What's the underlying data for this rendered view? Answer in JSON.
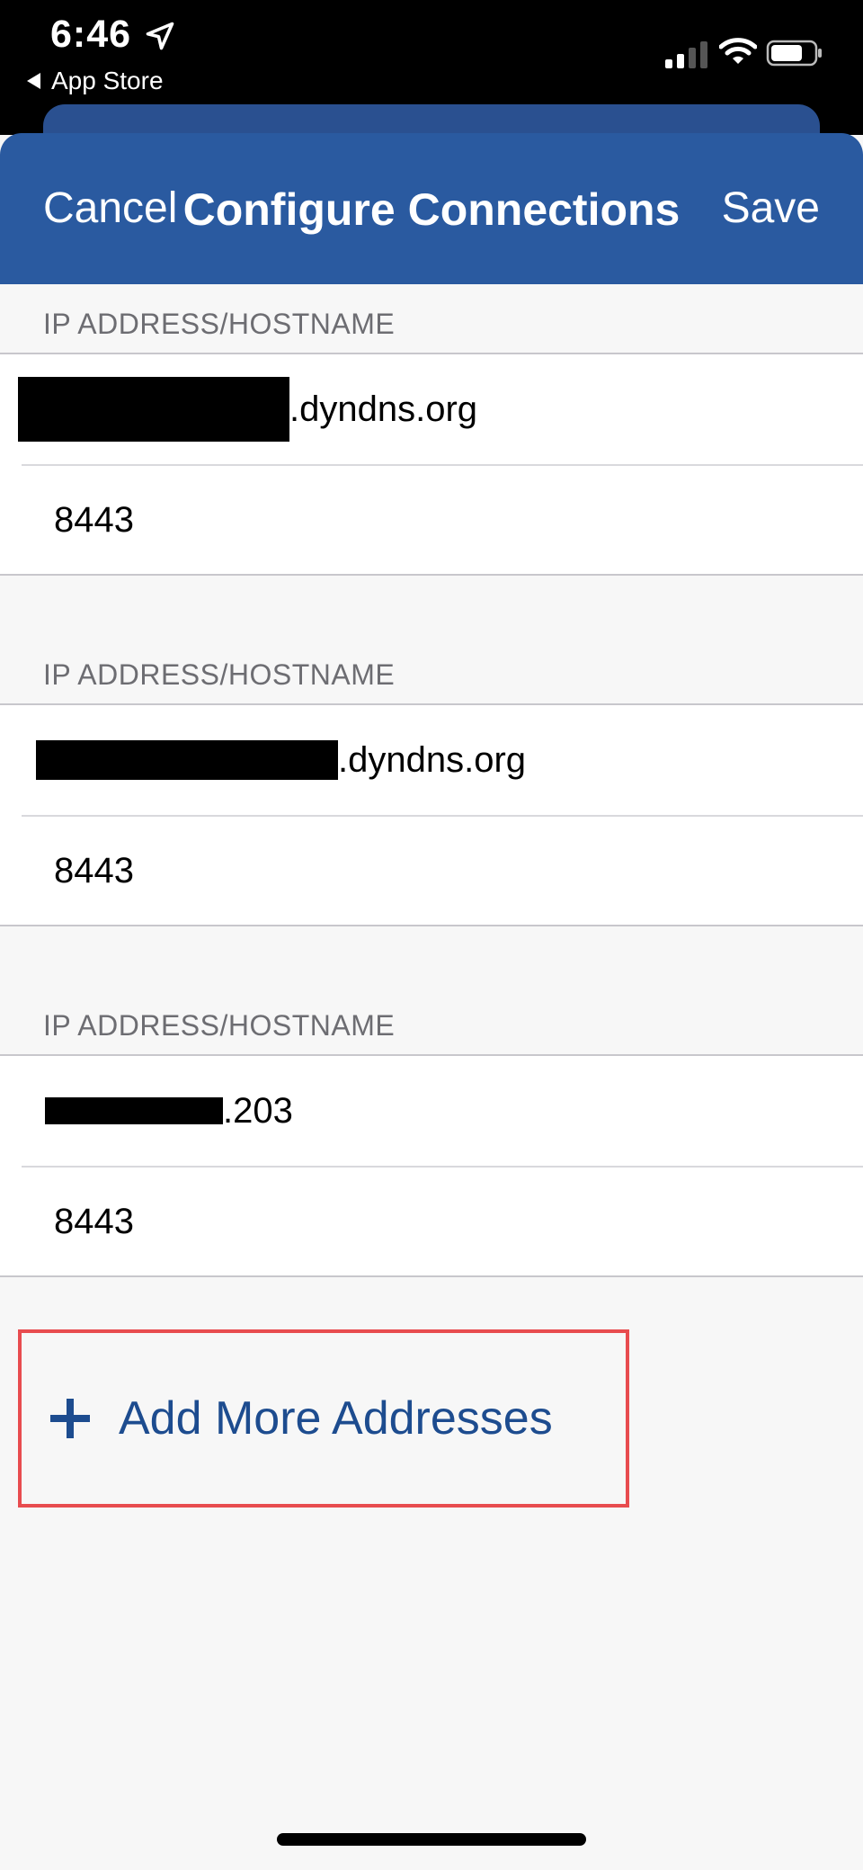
{
  "status_bar": {
    "time": "6:46",
    "back_label": "App Store"
  },
  "nav": {
    "cancel": "Cancel",
    "title": "Configure Connections",
    "save": "Save"
  },
  "sections": [
    {
      "header": "IP ADDRESS/HOSTNAME",
      "host": ".dyndns.org",
      "port": "8443"
    },
    {
      "header": "IP ADDRESS/HOSTNAME",
      "host": ".dyndns.org",
      "port": "8443"
    },
    {
      "header": "IP ADDRESS/HOSTNAME",
      "host": ".203",
      "port": "8443"
    }
  ],
  "add_more": {
    "label": "Add More Addresses",
    "icon": "plus-icon"
  },
  "colors": {
    "nav_bg": "#2a5aa0",
    "accent": "#1d4c8f",
    "highlight": "#e84c4f"
  }
}
